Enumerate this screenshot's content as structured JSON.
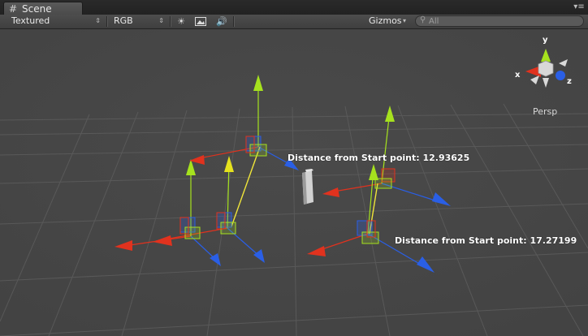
{
  "tab": {
    "title": "Scene",
    "menu_glyph": "▾≡"
  },
  "toolbar": {
    "render_mode": "Textured",
    "color_mode": "RGB",
    "gizmos_label": "Gizmos",
    "search_placeholder": "All",
    "icons": [
      "sun-lighting-icon",
      "image-icon",
      "audio-icon",
      "search-icon"
    ]
  },
  "scene": {
    "labels": [
      "Distance from Start point: 12.93625",
      "Distance from Start point: 17.27199"
    ],
    "view_gizmo": {
      "x_label": "x",
      "y_label": "y",
      "z_label": "z",
      "projection": "Persp"
    },
    "colors": {
      "x_axis": "#e1321e",
      "y_axis": "#a6e21e",
      "z_axis": "#2a5fe6",
      "line": "#f0e53a"
    }
  }
}
